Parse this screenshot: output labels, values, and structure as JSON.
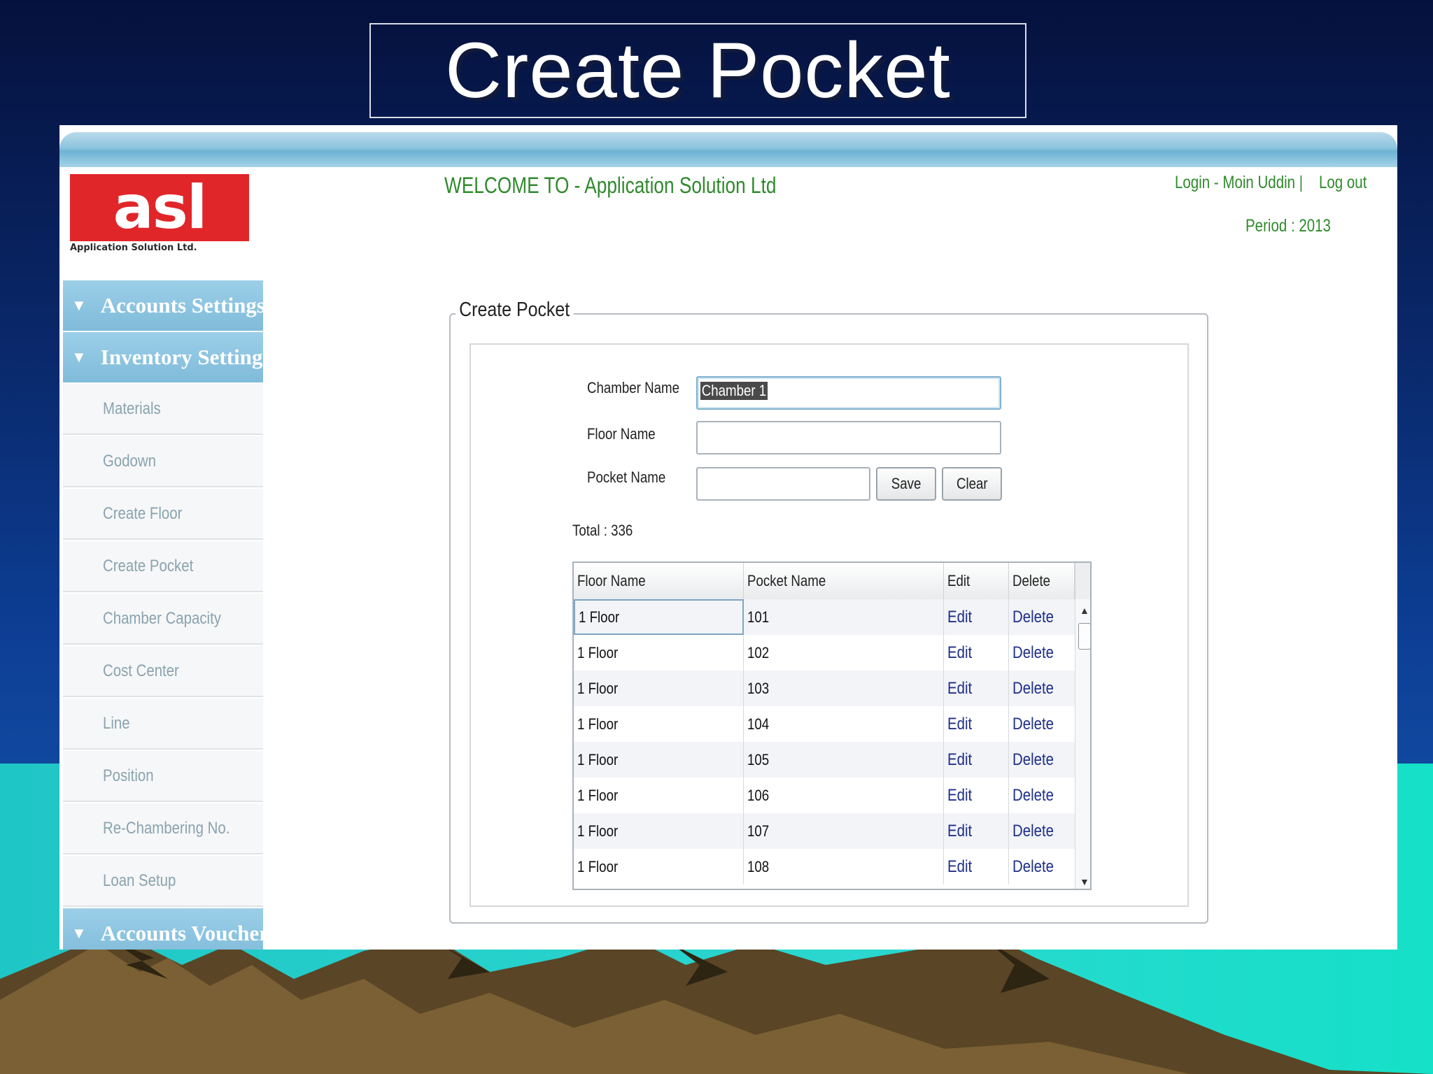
{
  "slide": {
    "title": "Create Pocket"
  },
  "header": {
    "logo_text": "asl",
    "logo_subtext": "Application Solution Ltd.",
    "welcome": "WELCOME TO - Application Solution Ltd",
    "login": "Login - Moin Uddin |",
    "logout": "Log out",
    "period": "Period : 2013"
  },
  "sidebar": {
    "sections": [
      {
        "label": "Accounts Settings"
      },
      {
        "label": "Inventory Settings"
      },
      {
        "label": "Accounts Voucher"
      }
    ],
    "items": [
      {
        "label": "Materials"
      },
      {
        "label": "Godown"
      },
      {
        "label": "Create Floor"
      },
      {
        "label": "Create Pocket"
      },
      {
        "label": "Chamber Capacity"
      },
      {
        "label": "Cost Center"
      },
      {
        "label": "Line"
      },
      {
        "label": "Position"
      },
      {
        "label": "Re-Chambering No."
      },
      {
        "label": "Loan Setup"
      }
    ],
    "arrow": "▼"
  },
  "form": {
    "legend": "Create Pocket",
    "chamber_label": "Chamber Name",
    "chamber_value": "Chamber 1",
    "floor_label": "Floor Name",
    "floor_value": "",
    "pocket_label": "Pocket Name",
    "pocket_value": "",
    "save": "Save",
    "clear": "Clear",
    "total": "Total : 336"
  },
  "grid": {
    "columns": [
      "Floor Name",
      "Pocket Name",
      "Edit",
      "Delete"
    ],
    "rows": [
      [
        "1 Floor",
        "101",
        "Edit",
        "Delete"
      ],
      [
        "1 Floor",
        "102",
        "Edit",
        "Delete"
      ],
      [
        "1 Floor",
        "103",
        "Edit",
        "Delete"
      ],
      [
        "1 Floor",
        "104",
        "Edit",
        "Delete"
      ],
      [
        "1 Floor",
        "105",
        "Edit",
        "Delete"
      ],
      [
        "1 Floor",
        "106",
        "Edit",
        "Delete"
      ],
      [
        "1 Floor",
        "107",
        "Edit",
        "Delete"
      ],
      [
        "1 Floor",
        "108",
        "Edit",
        "Delete"
      ]
    ]
  },
  "colors": {
    "accent_green": "#2f8a2c",
    "logo_red": "#e1262a",
    "sidebar_header": "#8ec6e2",
    "link_blue": "#1f2f8a"
  }
}
